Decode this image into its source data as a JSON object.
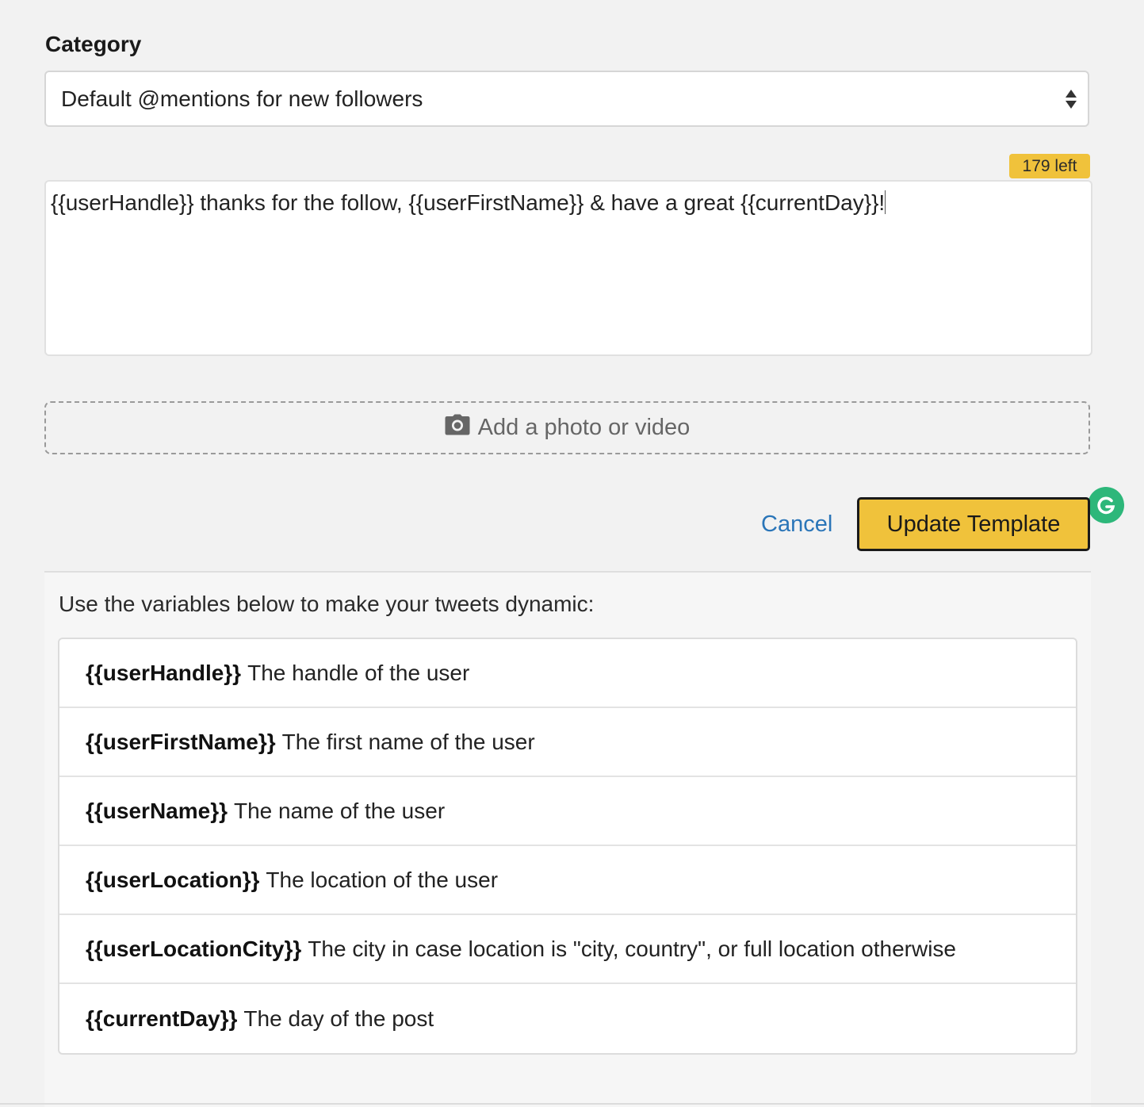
{
  "category": {
    "label": "Category",
    "selected": "Default @mentions for new followers"
  },
  "editor": {
    "counter": "179 left",
    "text": "{{userHandle}} thanks for the follow, {{userFirstName}} & have a great {{currentDay}}!"
  },
  "media": {
    "label": "Add a photo or video"
  },
  "actions": {
    "cancel_label": "Cancel",
    "update_label": "Update Template"
  },
  "variables": {
    "intro": "Use the variables below to make your tweets dynamic:",
    "items": [
      {
        "token": "{{userHandle}}",
        "description": "The handle of the user"
      },
      {
        "token": "{{userFirstName}}",
        "description": "The first name of the user"
      },
      {
        "token": "{{userName}}",
        "description": "The name of the user"
      },
      {
        "token": "{{userLocation}}",
        "description": "The location of the user"
      },
      {
        "token": "{{userLocationCity}}",
        "description": "The city in case location is \"city, country\", or full location otherwise"
      },
      {
        "token": "{{currentDay}}",
        "description": "The day of the post"
      }
    ]
  },
  "colors": {
    "accent": "#f0c23b",
    "link": "#2a75b8",
    "grammarly": "#2db77a"
  },
  "icons": {
    "media": "camera-icon",
    "editor_assistant": "grammarly-icon",
    "select": "select-arrows-icon"
  }
}
